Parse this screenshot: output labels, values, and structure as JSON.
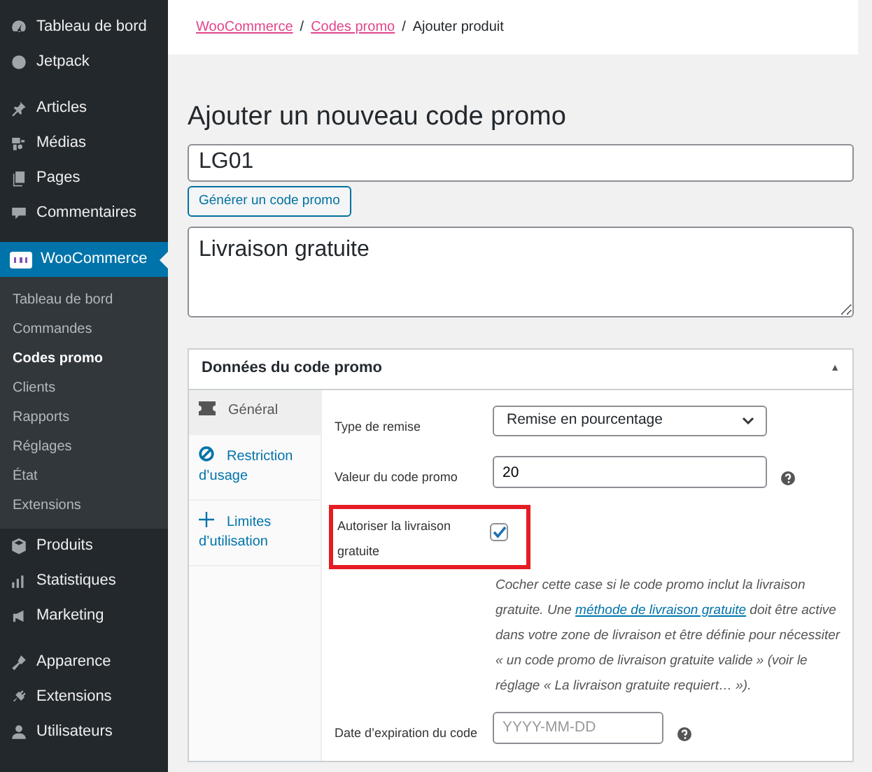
{
  "sidebar": {
    "groups": [
      [
        {
          "label": "Tableau de bord",
          "selected": false
        },
        {
          "label": "Jetpack",
          "selected": false
        }
      ],
      [
        {
          "label": "Articles",
          "selected": false
        },
        {
          "label": "Médias",
          "selected": false
        },
        {
          "label": "Pages",
          "selected": false
        },
        {
          "label": "Commentaires",
          "selected": false
        }
      ],
      [
        {
          "label": "WooCommerce",
          "selected": true,
          "children": [
            {
              "label": "Tableau de bord",
              "selected": false
            },
            {
              "label": "Commandes",
              "selected": false
            },
            {
              "label": "Codes promo",
              "selected": true
            },
            {
              "label": "Clients",
              "selected": false
            },
            {
              "label": "Rapports",
              "selected": false
            },
            {
              "label": "Réglages",
              "selected": false
            },
            {
              "label": "État",
              "selected": false
            },
            {
              "label": "Extensions",
              "selected": false
            }
          ]
        },
        {
          "label": "Produits",
          "selected": false
        },
        {
          "label": "Statistiques",
          "selected": false
        },
        {
          "label": "Marketing",
          "selected": false
        }
      ],
      [
        {
          "label": "Apparence",
          "selected": false
        },
        {
          "label": "Extensions",
          "selected": false
        },
        {
          "label": "Utilisateurs",
          "selected": false
        }
      ]
    ]
  },
  "breadcrumb": [
    {
      "label": "WooCommerce",
      "link": true
    },
    {
      "label": "Codes promo",
      "link": true
    },
    {
      "label": "Ajouter produit",
      "link": false
    }
  ],
  "breadcrumb_separator": "/",
  "heading": "Ajouter un nouveau code promo",
  "code_field": {
    "value": "LG01"
  },
  "generate_button": "Générer un code promo",
  "description_field": {
    "value": "Livraison gratuite"
  },
  "panel": {
    "title": "Données du code promo",
    "toggle": "▲",
    "tabs": [
      {
        "label": "Général",
        "selected": true
      },
      {
        "label": "Restriction d’usage",
        "selected": false
      },
      {
        "label": "Limites d’utilisation",
        "selected": false
      }
    ],
    "fields": [
      {
        "kind": "select",
        "label": "Type de remise",
        "value": "Remise en pourcentage"
      },
      {
        "kind": "text",
        "label": "Valeur du code promo",
        "value": "20",
        "help": true
      },
      {
        "kind": "checkbox",
        "label": "Autoriser la livraison gratuite",
        "checked": true,
        "highlighted": true,
        "description": {
          "before": "Cocher cette case si le code promo inclut la livraison gratuite. Une ",
          "link": "méthode de livraison gratuite",
          "after": " doit être active dans votre zone de livraison et être définie pour nécessiter « un code promo de livraison gratuite valide » (voir le réglage « La livraison gratuite requiert… »)."
        }
      },
      {
        "kind": "date",
        "label": "Date d’expiration du code",
        "placeholder": "YYYY-MM-DD",
        "help": true
      }
    ]
  }
}
